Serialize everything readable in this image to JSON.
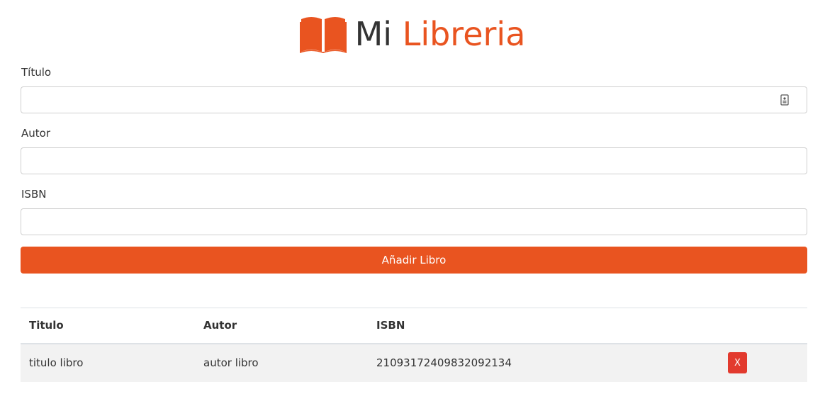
{
  "header": {
    "logo_icon": "open-book-icon",
    "title_part1": "Mi",
    "title_part2": "Libreria",
    "brand_color": "#E95420"
  },
  "form": {
    "title_label": "Título",
    "title_value": "",
    "author_label": "Autor",
    "author_value": "",
    "isbn_label": "ISBN",
    "isbn_value": "",
    "submit_label": "Añadir Libro"
  },
  "table": {
    "columns": [
      "Titulo",
      "Autor",
      "ISBN",
      ""
    ],
    "rows": [
      {
        "titulo": "titulo libro",
        "autor": "autor libro",
        "isbn": "21093172409832092134",
        "delete_label": "X"
      }
    ]
  },
  "colors": {
    "accent": "#E95420",
    "delete": "#E23A2E",
    "row_bg": "#f2f2f2"
  }
}
